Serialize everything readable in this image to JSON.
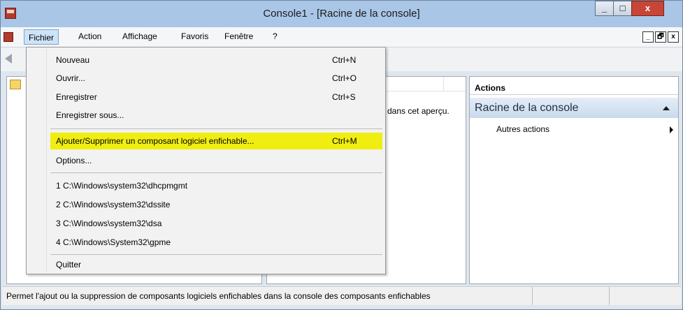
{
  "window": {
    "title": "Console1 - [Racine de la console]",
    "controls": {
      "minimize": "_",
      "maximize": "□",
      "close": "x"
    }
  },
  "menubar": {
    "items": [
      {
        "label": "Fichier",
        "active": true
      },
      {
        "label": "Action"
      },
      {
        "label": "Affichage"
      },
      {
        "label": "Favoris"
      },
      {
        "label": "Fenêtre"
      },
      {
        "label": "?"
      }
    ],
    "mdi_controls": {
      "minimize": "_",
      "restore": "🗗",
      "close": "x"
    }
  },
  "fichier_menu": {
    "items": [
      {
        "label": "Nouveau",
        "shortcut": "Ctrl+N"
      },
      {
        "label": "Ouvrir...",
        "shortcut": "Ctrl+O"
      },
      {
        "label": "Enregistrer",
        "shortcut": "Ctrl+S"
      },
      {
        "label": "Enregistrer sous...",
        "shortcut": ""
      },
      {
        "label": "Ajouter/Supprimer un composant logiciel enfichable...",
        "shortcut": "Ctrl+M",
        "highlighted": true
      },
      {
        "label": "Options...",
        "shortcut": ""
      },
      {
        "label": "1 C:\\Windows\\system32\\dhcpmgmt",
        "shortcut": ""
      },
      {
        "label": "2 C:\\Windows\\system32\\dssite",
        "shortcut": ""
      },
      {
        "label": "3 C:\\Windows\\system32\\dsa",
        "shortcut": ""
      },
      {
        "label": "4 C:\\Windows\\System32\\gpme",
        "shortcut": ""
      },
      {
        "label": "Quitter",
        "shortcut": ""
      }
    ]
  },
  "list_pane": {
    "empty_text": "dans cet aperçu."
  },
  "actions_pane": {
    "header": "Actions",
    "section": "Racine de la console",
    "items": [
      {
        "label": "Autres actions"
      }
    ]
  },
  "status_bar": {
    "text": "Permet l'ajout ou la suppression de composants logiciels enfichables dans la console des composants enfichables"
  },
  "colors": {
    "highlight": "#f0ee10",
    "titlebar": "#a9c6e6",
    "close_button": "#c74637"
  }
}
